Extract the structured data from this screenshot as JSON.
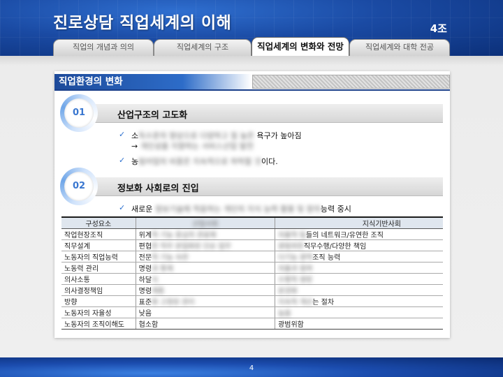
{
  "header": {
    "title": "진로상담 직업세계의 이해",
    "team": "4조"
  },
  "tabs": [
    {
      "label": "직업의 개념과 의의",
      "active": false
    },
    {
      "label": "직업세계의 구조",
      "active": false
    },
    {
      "label": "직업세계의 변화와 전망",
      "active": true
    },
    {
      "label": "직업세계와 대학 전공",
      "active": false
    }
  ],
  "section": {
    "title": "직업환경의 변화"
  },
  "items": [
    {
      "number": "01",
      "title": "산업구조의 고도화",
      "bullets": [
        {
          "line1_start": "소",
          "line1_blur": "득수준의 향상으로 다양하고 질 높은",
          "line1_end": " 욕구가 높아짐",
          "line2_start": "→",
          "line2_blur": " 개인성을 지향하는 서비스산업 발전"
        },
        {
          "line1_start": "농",
          "line1_blur": "림어업의 비중은 지속적으로 하락할 것",
          "line1_end": "이다."
        }
      ]
    },
    {
      "number": "02",
      "title": "정보화 사회로의 진입",
      "bullets": [
        {
          "line1_start": "새로운",
          "line1_blur": " 정보기술에 적응하는 개인의 지식 능력 활용 및 창의",
          "line1_end": "능력 중시"
        }
      ]
    }
  ],
  "table": {
    "headers": [
      "구성요소",
      "산업사회",
      "지식기반사회"
    ],
    "header_blur": [
      false,
      true,
      false
    ],
    "rows": [
      {
        "c1": "작업현장조직",
        "c2_start": "위계",
        "c2_blur": "적 기능 중심의 관료제",
        "c3_blur": "자율적 팀",
        "c3_end": "들의 네트워크/유연한 조직"
      },
      {
        "c1": "직무설계",
        "c2_start": "편협",
        "c2_blur": "한 직무 분업화된 단순 업무",
        "c3_blur": "광범위한",
        "c3_end": "직무수행/다양한 책임"
      },
      {
        "c1": "노동자의 직업능력",
        "c2_start": "전문",
        "c2_blur": "적 기능 숙련",
        "c3_blur": "다기능 광역",
        "c3_end": "조직 능력"
      },
      {
        "c1": "노동력 관리",
        "c2_start": "명령",
        "c2_blur": "과 통제",
        "c3_blur": "자율과 참여",
        "c3_end": ""
      },
      {
        "c1": "의사소통",
        "c2_start": "하달",
        "c2_blur": "식",
        "c3_blur": "수평적 쌍방",
        "c3_end": ""
      },
      {
        "c1": "의사결정책임",
        "c2_start": "명령",
        "c2_blur": "계통",
        "c3_blur": "분권화",
        "c3_end": ""
      },
      {
        "c1": "방향",
        "c2_start": "표준",
        "c2_blur": "화 고정된 관리",
        "c3_blur": "지속적 개선",
        "c3_end": "는 절차"
      },
      {
        "c1": "노동자의 자율성",
        "c2_start": "낮음",
        "c2_blur": "",
        "c3_blur": "높음",
        "c3_end": ""
      },
      {
        "c1": "노동자의 조직이해도",
        "c2_start": "협소함",
        "c2_blur": "",
        "c3_blur": "",
        "c3_end": "광범위함"
      }
    ]
  },
  "footer": {
    "page": "4"
  }
}
